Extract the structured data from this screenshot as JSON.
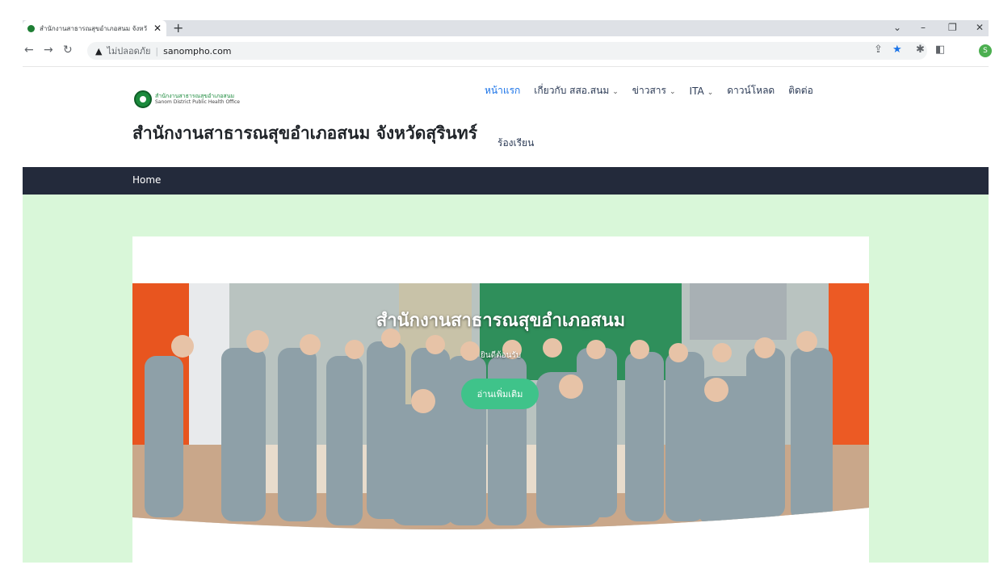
{
  "browser": {
    "tab_title": "สำนักงานสาธารณสุขอำเภอสนม จังหวั",
    "tab_close": "✕",
    "new_tab": "+",
    "url_warning_icon": "warning-icon",
    "insecure_label": "ไม่ปลอดภัย",
    "url_separator": "|",
    "url": "sanompho.com",
    "profile_initial": "S"
  },
  "site": {
    "logo_th": "สำนักงานสาธารณสุขอำเภอสนม",
    "logo_en": "Sanom District Public Health Office",
    "title": "สำนักงานสาธารณสุขอำเภอสนม จังหวัดสุรินทร์",
    "menu": [
      {
        "label": "หน้าแรก",
        "has_dropdown": false
      },
      {
        "label": "เกี่ยวกับ สสอ.สนม",
        "has_dropdown": true
      },
      {
        "label": "ข่าวสาร",
        "has_dropdown": true
      },
      {
        "label": "ITA",
        "has_dropdown": true
      },
      {
        "label": "ดาวน์โหลด",
        "has_dropdown": false
      },
      {
        "label": "ติดต่อ",
        "has_dropdown": false
      }
    ],
    "menu_second_row": "ร้องเรียน",
    "breadcrumb": "Home"
  },
  "hero": {
    "title": "สำนักงานสาธารณสุขอำเภอสนม",
    "subtitle": "ยินดีต้อนรับ",
    "button_label": "อ่านเพิ่มเติม"
  },
  "colors": {
    "accent": "#1a73e8",
    "breadcrumb_bar": "#232a3b",
    "content_bg": "#d9f7d9",
    "hero_button": "#3fc38a"
  }
}
